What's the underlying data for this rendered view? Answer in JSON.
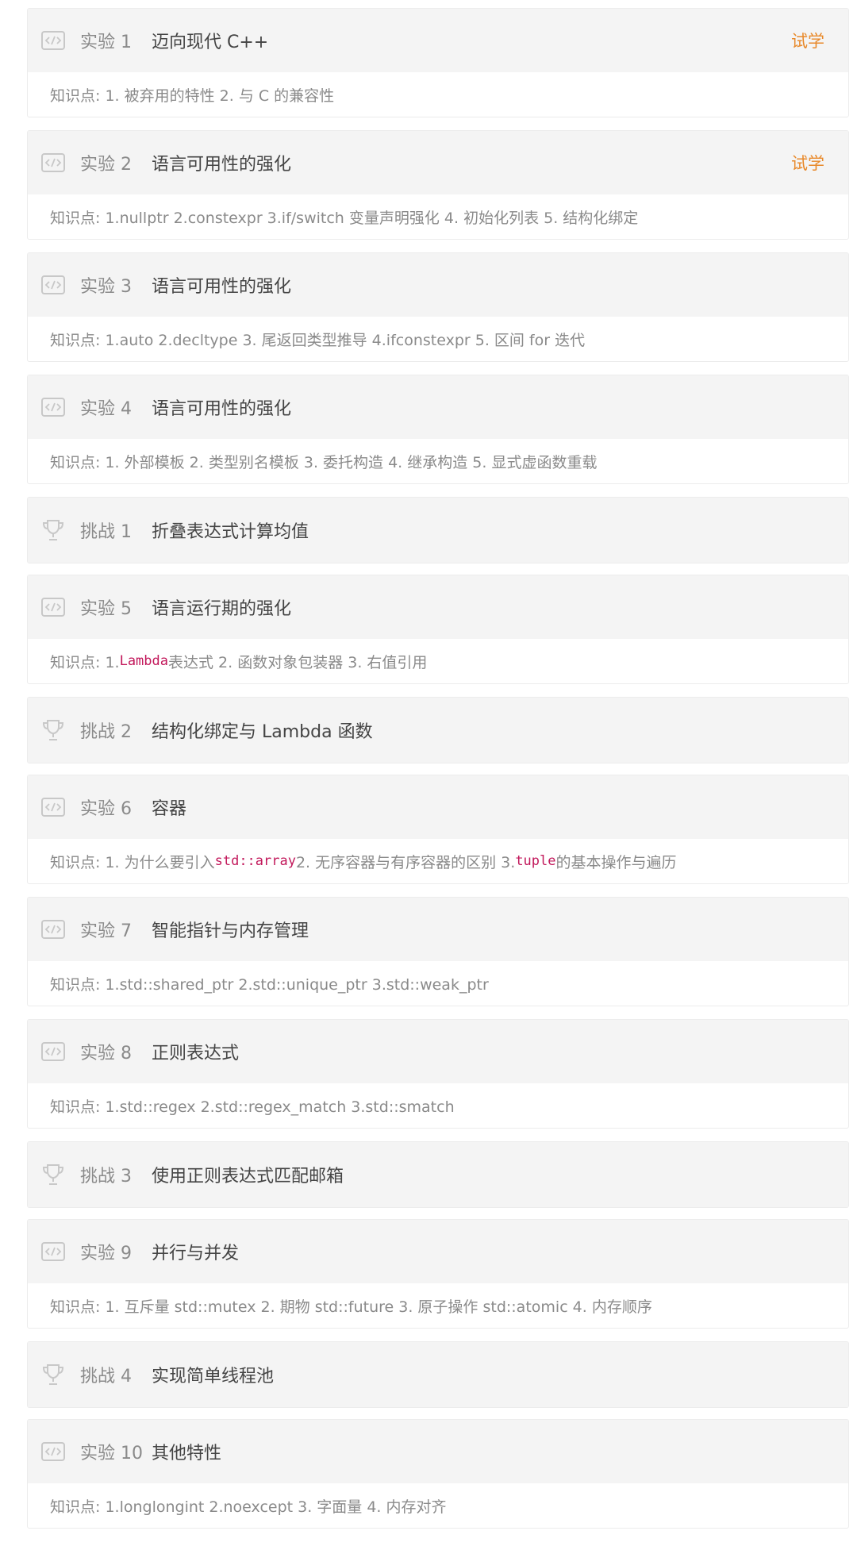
{
  "trial_label": "试学",
  "labs": [
    {
      "num": "实验 1",
      "title": "迈向现代 C++",
      "trial": true,
      "points": "知识点: 1. 被弃用的特性 2. 与 C 的兼容性"
    },
    {
      "num": "实验 2",
      "title": "语言可用性的强化",
      "trial": true,
      "points": "知识点: 1.nullptr 2.constexpr 3.if/switch 变量声明强化 4. 初始化列表 5. 结构化绑定"
    },
    {
      "num": "实验 3",
      "title": "语言可用性的强化",
      "points": "知识点: 1.auto 2.decltype 3. 尾返回类型推导 4.ifconstexpr 5. 区间 for 迭代"
    },
    {
      "num": "实验 4",
      "title": "语言可用性的强化",
      "points": "知识点: 1. 外部模板 2. 类型别名模板 3. 委托构造 4. 继承构造 5. 显式虚函数重载"
    },
    {
      "num": "挑战 1",
      "title": "折叠表达式计算均值"
    },
    {
      "num": "实验 5",
      "title": "语言运行期的强化",
      "points_pre": "知识点: 1.",
      "points_code1": "Lambda",
      "points_mid": " 表达式 2. 函数对象包装器 3. 右值引用"
    },
    {
      "num": "挑战 2",
      "title": "结构化绑定与 Lambda 函数"
    },
    {
      "num": "实验 6",
      "title": "容器",
      "points_pre": "知识点: 1. 为什么要引入 ",
      "points_code1": "std::array",
      "points_mid": " 2. 无序容器与有序容器的区别 3.",
      "points_code2": "tuple",
      "points_post": " 的基本操作与遍历"
    },
    {
      "num": "实验 7",
      "title": "智能指针与内存管理",
      "points": "知识点: 1.std::shared_ptr 2.std::unique_ptr 3.std::weak_ptr"
    },
    {
      "num": "实验 8",
      "title": "正则表达式",
      "points": "知识点: 1.std::regex 2.std::regex_match 3.std::smatch"
    },
    {
      "num": "挑战 3",
      "title": "使用正则表达式匹配邮箱"
    },
    {
      "num": "实验 9",
      "title": "并行与并发",
      "points": "知识点: 1. 互斥量 std::mutex 2. 期物 std::future 3. 原子操作 std::atomic 4. 内存顺序"
    },
    {
      "num": "挑战 4",
      "title": "实现简单线程池"
    },
    {
      "num": "实验 10",
      "title": "其他特性",
      "points": "知识点: 1.longlongint 2.noexcept 3. 字面量 4. 内存对齐"
    }
  ],
  "colors": {
    "trial": "#e8892a",
    "code": "#c2185b"
  },
  "icons": {
    "lab": "code-icon",
    "challenge": "trophy-icon"
  }
}
